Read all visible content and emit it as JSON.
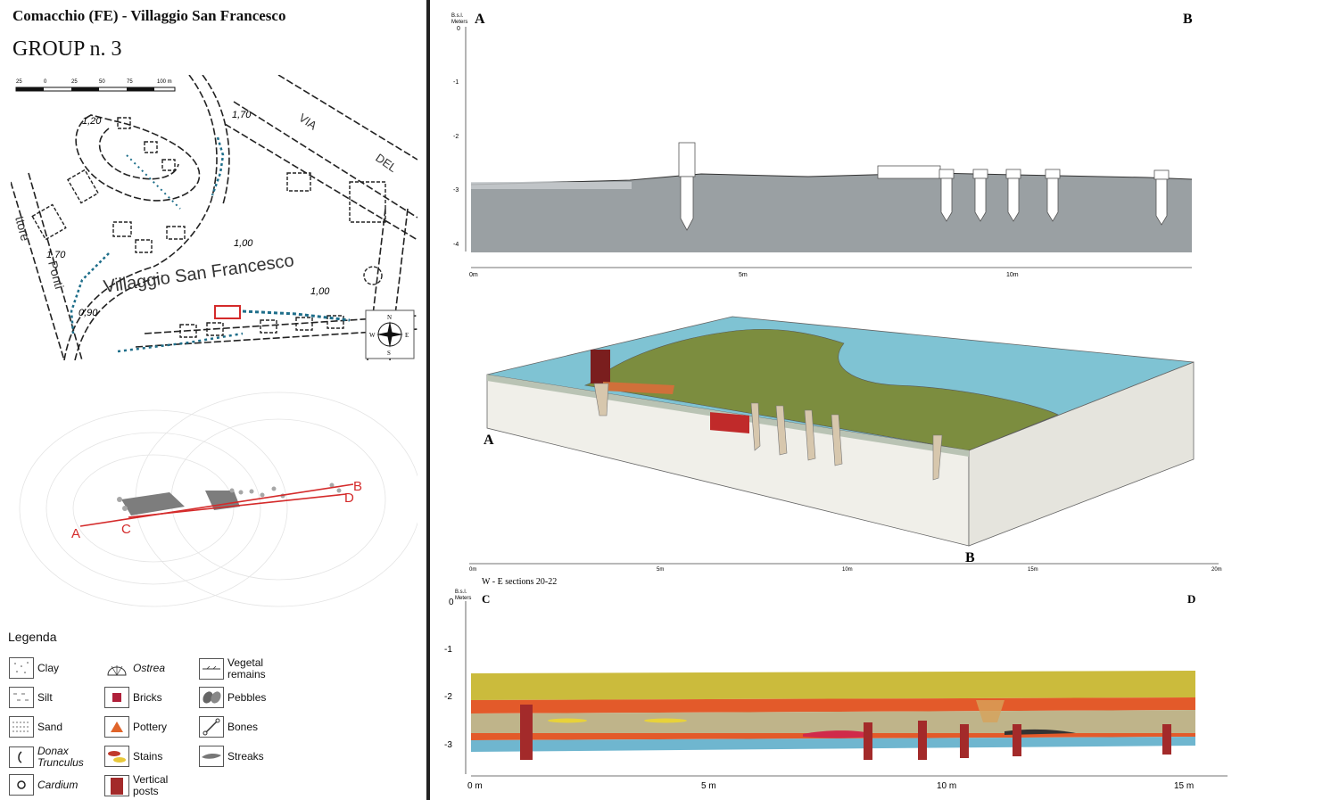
{
  "header": {
    "site_title": "Comacchio (FE) - Villaggio San Francesco",
    "group_title": "GROUP n. 3"
  },
  "map": {
    "scale_ticks": [
      "25",
      "0",
      "25",
      "50",
      "75",
      "100 m"
    ],
    "village_label": "Villaggio San Francesco",
    "street_via": "VIA",
    "street_del": "DEL",
    "street_tore": "ttore",
    "street_ponti": "Ponti",
    "elevations": [
      "1,20",
      "1,70",
      "1,00",
      "1,70",
      "1,00",
      "0,90"
    ],
    "compass": {
      "n": "N",
      "s": "S",
      "e": "E",
      "w": "W"
    }
  },
  "plan": {
    "labels": {
      "a": "A",
      "b": "B",
      "c": "C",
      "d": "D"
    },
    "line_color": "#d42a2a"
  },
  "legend": {
    "title": "Legenda",
    "items": [
      {
        "label": "Clay",
        "italic": false
      },
      {
        "label": "Silt",
        "italic": false
      },
      {
        "label": "Sand",
        "italic": false
      },
      {
        "label": "Donax",
        "sub": "Trunculus",
        "italic": true
      },
      {
        "label": "Cardium",
        "italic": true
      },
      {
        "label": "Ostrea",
        "italic": true
      },
      {
        "label": "Bricks",
        "italic": false
      },
      {
        "label": "Pottery",
        "italic": false
      },
      {
        "label": "Stains",
        "italic": false
      },
      {
        "label": "Vertical",
        "sub": "posts",
        "italic": false
      },
      {
        "label": "Vegetal",
        "sub": "remains",
        "italic": false
      },
      {
        "label": "Pebbles",
        "italic": false
      },
      {
        "label": "Bones",
        "italic": false
      },
      {
        "label": "Streaks",
        "italic": false
      }
    ]
  },
  "section_ab": {
    "y_axis_title": [
      "B.s.l.",
      "Meters"
    ],
    "corner_left": "A",
    "corner_right": "B",
    "y_ticks": [
      "0",
      "-1",
      "-2",
      "-3",
      "-4"
    ],
    "x_ticks": [
      "0m",
      "5m",
      "10m"
    ],
    "fill_color": "#9aa0a3"
  },
  "block_3d": {
    "corner_a": "A",
    "corner_b": "B",
    "x_ticks": [
      "0m",
      "5m",
      "10m",
      "15m",
      "20m"
    ],
    "colors": {
      "top_green": "#7c8d3f",
      "water": "#7fc3d3",
      "side": "#f0efe9",
      "brick": "#c02a2a"
    }
  },
  "section_cd": {
    "caption": "W - E sections 20-22",
    "y_axis_title": [
      "B.s.l.",
      "Meters"
    ],
    "corner_left": "C",
    "corner_right": "D",
    "y_ticks": [
      "0",
      "-1",
      "-2",
      "-3"
    ],
    "x_ticks": [
      "0 m",
      "5 m",
      "10 m",
      "15 m"
    ],
    "colors": {
      "yellow": "#cbbb3c",
      "orange": "#e35a2a",
      "silt": "#bfb48a",
      "blue": "#6fb6cf",
      "post": "#a32a2a"
    }
  }
}
